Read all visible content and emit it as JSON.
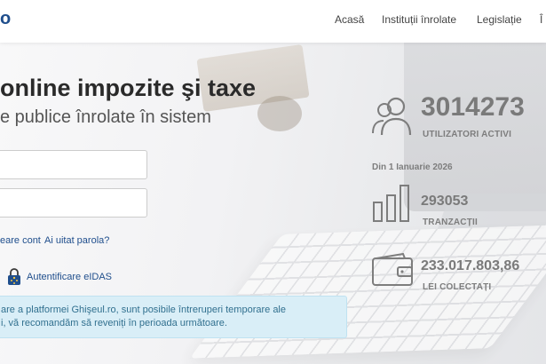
{
  "header": {
    "logo_fragment": "o",
    "nav": [
      "Acasă",
      "Instituții înrolate",
      "Legislație",
      "Î"
    ]
  },
  "hero": {
    "title": "online impozite şi taxe",
    "subtitle": "e publice înrolate în sistem"
  },
  "login": {
    "links": [
      "eare cont",
      "Ai uitat parola?"
    ],
    "eidas_label": "Autentificare eIDAS"
  },
  "notice": {
    "line1": "are a platformei Ghişeul.ro, sunt posibile întreruperi temporare ale",
    "line2": "i, vă recomandăm să reveniți în perioada următoare."
  },
  "stats": {
    "users": {
      "value": "3014273",
      "label": "UTILIZATORI ACTIVI",
      "icon": "users-icon"
    },
    "since": "Din 1 Ianuarie 2026",
    "transactions": {
      "value": "293053",
      "label": "TRANZACȚII",
      "icon": "bar-chart-icon"
    },
    "collected": {
      "value": "233.017.803,86",
      "label": "LEI COLECTAȚI",
      "icon": "wallet-icon"
    }
  },
  "colors": {
    "brand": "#1f4e8c",
    "notice_bg": "#d9eef7",
    "stat_gray": "#7a7a7a"
  }
}
